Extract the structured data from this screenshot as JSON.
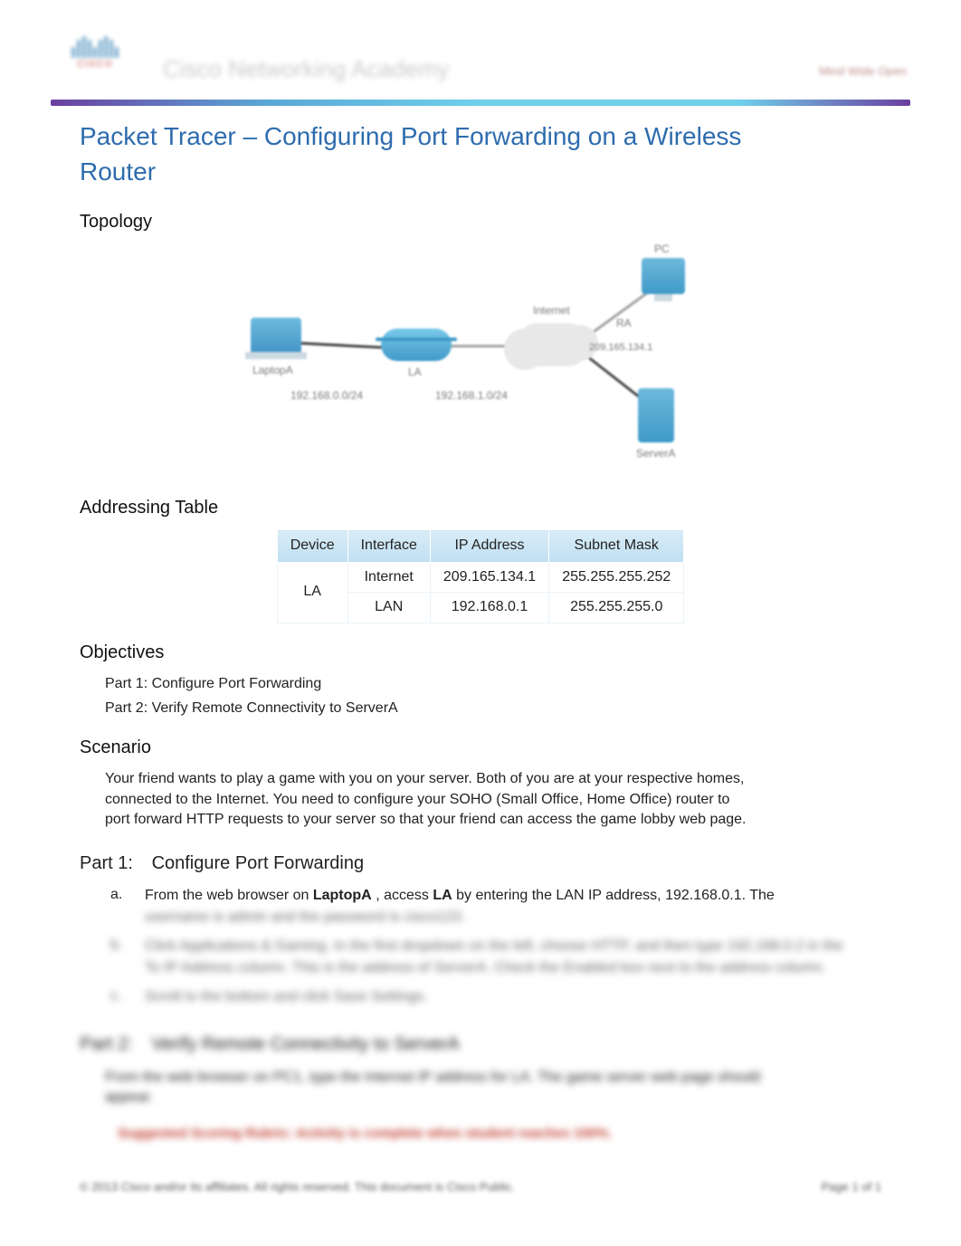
{
  "header": {
    "brand_title": "Cisco Networking Academy",
    "tagline": "Mind Wide Open"
  },
  "title": "Packet Tracer – Configuring Port Forwarding on a Wireless Router",
  "sections": {
    "topology": "Topology",
    "addressing": "Addressing Table",
    "objectives": "Objectives",
    "scenario": "Scenario"
  },
  "topology_labels": {
    "laptopA": "LaptopA",
    "la": "LA",
    "la_ip": "192.168.0.0/24",
    "internet": "Internet",
    "ra_ip": "192.168.1.0/24",
    "ra": "RA",
    "ra_wan": "209.165.134.1",
    "serverA": "ServerA",
    "pc": "PC"
  },
  "addr_table": {
    "headers": {
      "device": "Device",
      "interface": "Interface",
      "ip": "IP Address",
      "mask": "Subnet Mask"
    },
    "rows": [
      {
        "device": "LA",
        "interface": "Internet",
        "ip": "209.165.134.1",
        "mask": "255.255.255.252"
      },
      {
        "device": "",
        "interface": "LAN",
        "ip": "192.168.0.1",
        "mask": "255.255.255.0"
      }
    ]
  },
  "objectives": [
    "Part 1: Configure Port Forwarding",
    "Part 2: Verify Remote Connectivity to ServerA"
  ],
  "scenario_text": "Your friend wants to play a game with you on your server. Both of you are at your respective homes, connected to the Internet. You need to configure your SOHO (Small Office, Home Office) router to port forward HTTP requests to your server so that your friend can access the game lobby web page.",
  "part1": {
    "num": "Part 1:",
    "title": "Configure Port Forwarding",
    "steps": {
      "a_prefix": "a.",
      "a_text_1": "From the web browser on ",
      "a_bold_1": "LaptopA",
      "a_text_2": ", access ",
      "a_bold_2": "LA",
      "a_text_3": " by entering the LAN IP address, 192.168.0.1. The",
      "a_blur_line": "username is admin and the password is cisco123.",
      "b_prefix": "b.",
      "b_blur": "Click Applications & Gaming. In the first dropdown on the left, choose HTTP, and then type 192.168.0.2 in the To IP Address column. This is the address of ServerA. Check the Enabled box next to the address column.",
      "c_prefix": "c.",
      "c_blur": "Scroll to the bottom and click Save Settings."
    }
  },
  "part2": {
    "num": "Part 2:",
    "title": "Verify Remote Connectivity to ServerA",
    "para": "From the web browser on PC1, type the Internet IP address for LA. The game server web page should appear."
  },
  "red_line": "Suggested Scoring Rubric: Activity is complete when student reaches 100%.",
  "footer": {
    "left": "© 2013 Cisco and/or its affiliates. All rights reserved. This document is Cisco Public.",
    "right": "Page 1 of 1"
  }
}
